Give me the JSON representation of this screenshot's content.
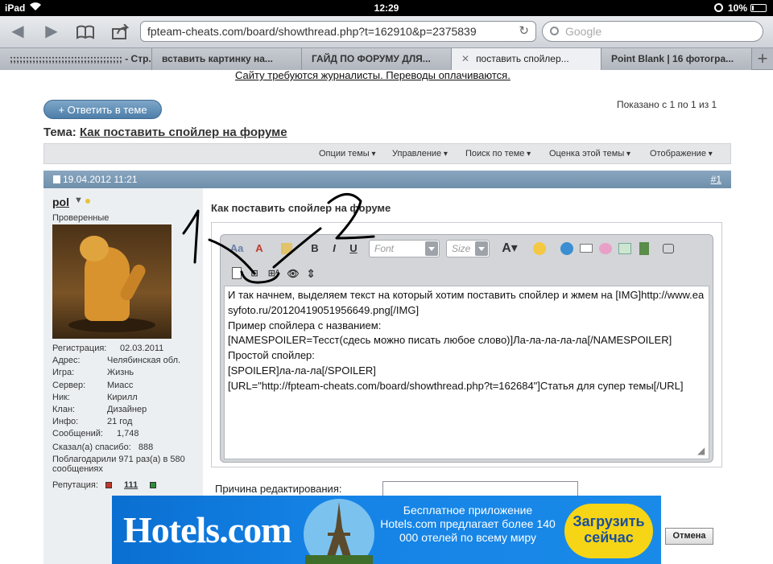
{
  "statusbar": {
    "device": "iPad",
    "time": "12:29",
    "battery": "10%"
  },
  "browser": {
    "url": "fpteam-cheats.com/board/showthread.php?t=162910&p=2375839",
    "search_placeholder": "Google",
    "tabs": [
      {
        "label": ";;;;;;;;;;;;;;;;;;;;;;;;;;;;;;;;;;; - Стр..."
      },
      {
        "label": "вставить картинку на..."
      },
      {
        "label": "ГАЙД ПО ФОРУМУ ДЛЯ..."
      },
      {
        "label": "поставить спойлер..."
      },
      {
        "label": "Point Blank | 16 фотогра..."
      }
    ]
  },
  "page": {
    "banner": "Сайту требуются журналисты. Переводы оплачиваются.",
    "reply_button": "+ Ответить в теме",
    "shown": "Показано с 1 по 1 из 1",
    "topic_label": "Тема:",
    "topic_title": "Как поставить спойлер на форуме",
    "menu": [
      "Опции темы",
      "Управление",
      "Поиск по теме",
      "Оценка этой темы",
      "Отображение"
    ],
    "post_date": "19.04.2012 11:21",
    "post_number": "#1"
  },
  "user": {
    "name": "pol",
    "role": "Проверенные",
    "info": [
      {
        "k": "Регистрация:",
        "v": "02.03.2011"
      },
      {
        "k": "Адрес:",
        "v": "Челябинская обл."
      },
      {
        "k": "Игра:",
        "v": "Жизнь"
      },
      {
        "k": "Сервер:",
        "v": "Миасс"
      },
      {
        "k": "Ник:",
        "v": "Кирилл"
      },
      {
        "k": "Клан:",
        "v": "Дизайнер"
      },
      {
        "k": "Инфо:",
        "v": "21 год"
      },
      {
        "k": "Сообщений:",
        "v": "1,748"
      }
    ],
    "thanks_said": "Сказал(а) спасибо:   888",
    "thanked": "Поблагодарили 971 раз(а) в 580 сообщениях",
    "reputation_label": "Репутация:",
    "reputation_value": "111"
  },
  "post": {
    "title": "Как поставить спойлер на форуме",
    "font_placeholder": "Font",
    "size_placeholder": "Size",
    "body": "И так начнем, выделяем текст на который хотим поставить спойлер и жмем на [IMG]http://www.easyfoto.ru/20120419051956649.png[/IMG]\nПример спойлера с названием:\n[NAMESPOILER=Тесст(сдесь можно писать любое слово)]Ла-ла-ла-ла-ла[/NAMESPOILER]\nПростой спойлер:\n[SPOILER]ла-ла-ла[/SPOILER]\n[URL=\"http://fpteam-cheats.com/board/showthread.php?t=162684\"]Статья для супер темы[/URL]",
    "reason_label": "Причина редактирования:",
    "cancel": "Отмена"
  },
  "ad": {
    "logo": "Hotels.com",
    "text": "Бесплатное приложение Hotels.com предлагает более 140 000 отелей по всему миру",
    "button": "Загрузить сейчас"
  },
  "annotation": {
    "label1": "1",
    "label2": "2"
  },
  "colors": {
    "post_header": "#7b9ab5",
    "reply_button": "#5c8bb5",
    "ad_bg": "#1583e6",
    "ad_button": "#f6d516"
  }
}
